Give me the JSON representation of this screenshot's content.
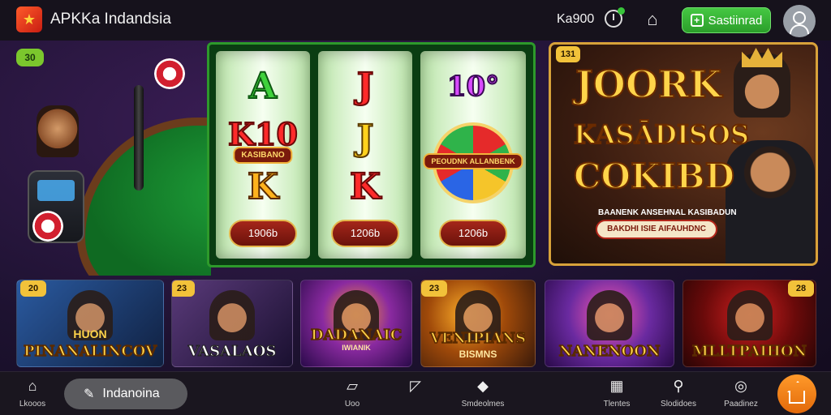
{
  "header": {
    "logo_text": "★",
    "title": "APKKa Indandsia",
    "balance": "Ka900",
    "signin_label": "Sastiinrad",
    "icons": [
      "logo-icon",
      "clock-icon",
      "gift-icon",
      "plus-icon",
      "user-icon"
    ]
  },
  "left": {
    "badge": "30"
  },
  "reels": {
    "reel1": {
      "top": "A",
      "banner_top": "K10",
      "banner": "KASIBANO",
      "mid": "K",
      "button": "1906b"
    },
    "reel2": {
      "top": "J",
      "mid1": "J",
      "mid2": "K",
      "button": "1206b"
    },
    "reel3": {
      "top": "10°",
      "banner": "PEOUDNK ALLANBENK",
      "button": "1206b"
    }
  },
  "promo": {
    "badge": "131",
    "line1": "JOORK",
    "line2": "KASĀDISOS",
    "line3": "COKIBD",
    "sub": "BAANENK ANSEHNAL KASIBADUN",
    "cta": "BAKDHI ISIE AIFAUHDNC"
  },
  "games": [
    {
      "badge": "20",
      "title": "PINANALINCOV",
      "subtitle": "HUON",
      "bg": "#1c3a6a",
      "accent": "#3aa0ff"
    },
    {
      "badge": "23",
      "title": "VASALAOS",
      "subtitle": "",
      "bg": "#3a2a5a",
      "accent": "#c94a3a"
    },
    {
      "badge": "",
      "title": "DADANAIC",
      "subtitle": "IWIANIK",
      "bg": "#4a1a6a",
      "accent": "#ff8a2a"
    },
    {
      "badge": "23",
      "title": "VENIPIANS",
      "subtitle": "BISMNS",
      "bg": "#6a2a0a",
      "accent": "#ffb02a"
    },
    {
      "badge": "",
      "title": "NANENOON",
      "subtitle": "",
      "bg": "#3a1a6a",
      "accent": "#ff5ab0"
    },
    {
      "badge": "28",
      "title": "MLLTPAIHON",
      "subtitle": "",
      "bg": "#5a0a0a",
      "accent": "#d02020"
    }
  ],
  "bottom_nav": {
    "home_label": "Lkooos",
    "language_label": "Indanoina",
    "items": [
      {
        "label": "Uoo",
        "icon": "box-icon"
      },
      {
        "label": "",
        "icon": "send-icon"
      },
      {
        "label": "Smdeolmes",
        "icon": "tag-icon"
      },
      {
        "label": "Tlentes",
        "icon": "calendar-icon"
      },
      {
        "label": "Slodidoes",
        "icon": "location-icon"
      },
      {
        "label": "Paadinez",
        "icon": "headset-icon"
      }
    ]
  },
  "colors": {
    "accent_green": "#38c53a",
    "gold": "#ffd44a",
    "home_fab": "#f08a1a"
  }
}
